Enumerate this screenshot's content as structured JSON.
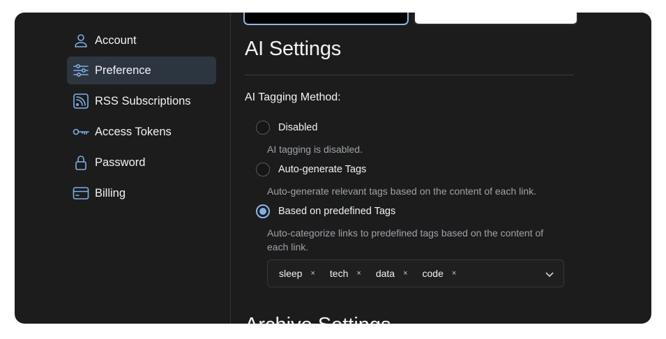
{
  "sidebar": {
    "items": [
      {
        "label": "Account",
        "icon": "user-icon"
      },
      {
        "label": "Preference",
        "icon": "sliders-icon",
        "active": true
      },
      {
        "label": "RSS Subscriptions",
        "icon": "rss-icon"
      },
      {
        "label": "Access Tokens",
        "icon": "key-icon"
      },
      {
        "label": "Password",
        "icon": "lock-icon"
      },
      {
        "label": "Billing",
        "icon": "credit-card-icon"
      }
    ]
  },
  "ai_settings": {
    "title": "AI Settings",
    "tagging_label": "AI Tagging Method:",
    "options": [
      {
        "label": "Disabled",
        "description": "AI tagging is disabled.",
        "checked": false
      },
      {
        "label": "Auto-generate Tags",
        "description": "Auto-generate relevant tags based on the content of each link.",
        "checked": false
      },
      {
        "label": "Based on predefined Tags",
        "description": "Auto-categorize links to predefined tags based on the content of each link.",
        "checked": true
      }
    ],
    "tags": [
      "sleep",
      "tech",
      "data",
      "code"
    ],
    "tag_remove_glyph": "×"
  },
  "archive_settings": {
    "title": "Archive Settings"
  },
  "colors": {
    "accent": "#7fb0e6",
    "background": "#1c1c1d",
    "active_item": "#2d3540"
  }
}
